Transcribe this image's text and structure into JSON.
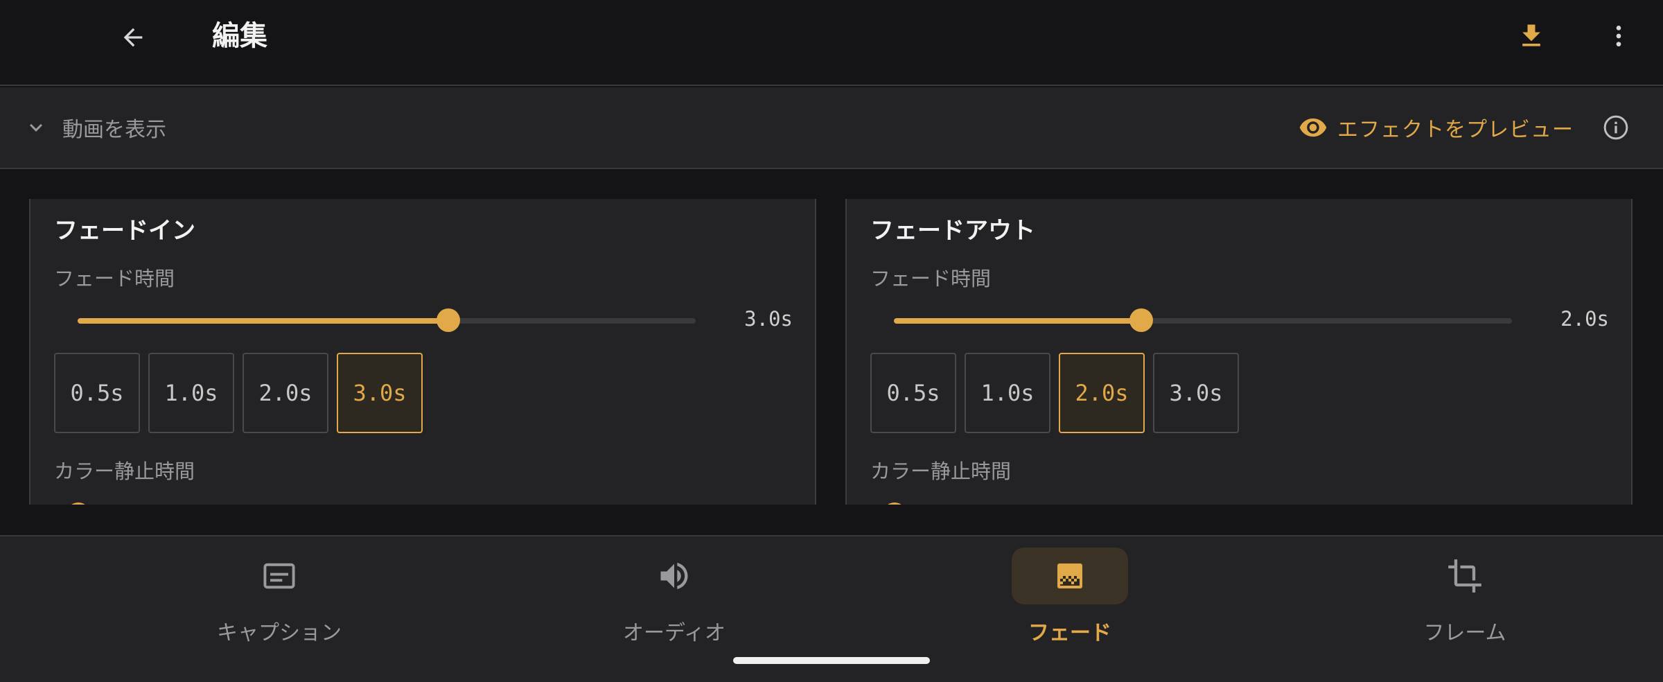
{
  "appbar": {
    "title": "編集",
    "icons": {
      "back": "arrow-left-icon",
      "download": "download-icon",
      "more": "more-vert-icon"
    }
  },
  "preview_bar": {
    "toggle_label": "動画を表示",
    "preview_label": "エフェクトをプレビュー",
    "icons": {
      "toggle": "chevron-down-icon",
      "preview": "eye-icon",
      "info": "info-icon"
    }
  },
  "fade_in": {
    "heading": "フェードイン",
    "duration_label": "フェード時間",
    "duration_value": "3.0s",
    "slider_fraction": 0.6,
    "chips": [
      "0.5s",
      "1.0s",
      "2.0s",
      "3.0s"
    ],
    "selected_chip": 3,
    "hold_label": "カラー静止時間"
  },
  "fade_out": {
    "heading": "フェードアウト",
    "duration_label": "フェード時間",
    "duration_value": "2.0s",
    "slider_fraction": 0.4,
    "chips": [
      "0.5s",
      "1.0s",
      "2.0s",
      "3.0s"
    ],
    "selected_chip": 2,
    "hold_label": "カラー静止時間"
  },
  "bottom_nav": {
    "items": [
      {
        "label": "キャプション",
        "icon": "subtitles-icon"
      },
      {
        "label": "オーディオ",
        "icon": "volume-icon"
      },
      {
        "label": "フェード",
        "icon": "gradient-icon"
      },
      {
        "label": "フレーム",
        "icon": "crop-icon"
      }
    ],
    "active_index": 2
  },
  "colors": {
    "accent": "#e2a948",
    "background": "#141416",
    "surface": "#232325",
    "muted_text": "#9a9a9c"
  }
}
